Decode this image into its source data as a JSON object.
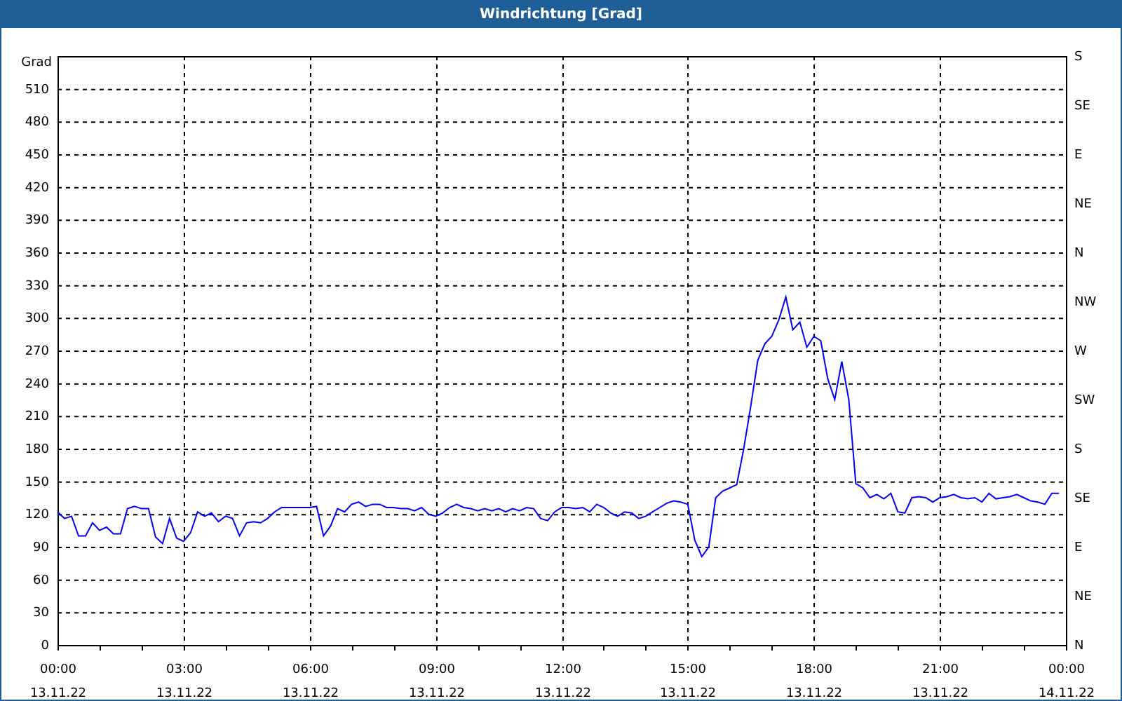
{
  "window": {
    "title": "Windrichtung [Grad]"
  },
  "chart": {
    "chart_data": {
      "type": "line",
      "grid": true,
      "ylabel": "Grad",
      "ylim": [
        0,
        540
      ],
      "yticks": [
        0,
        30,
        60,
        90,
        120,
        150,
        180,
        210,
        240,
        270,
        300,
        330,
        360,
        390,
        420,
        450,
        480,
        510
      ],
      "categories": [
        "00:00\n13.11.22",
        null,
        null,
        null,
        null,
        null,
        null,
        null,
        null,
        null,
        null,
        null,
        null,
        null,
        null,
        null,
        null,
        null,
        "03:00\n13.11.22",
        null,
        null,
        null,
        null,
        null,
        null,
        null,
        null,
        null,
        null,
        null,
        null,
        null,
        null,
        null,
        null,
        null,
        "06:00\n13.11.22",
        null,
        null,
        null,
        null,
        null,
        null,
        null,
        null,
        null,
        null,
        null,
        null,
        null,
        null,
        null,
        null,
        null,
        "09:00\n13.11.22",
        null,
        null,
        null,
        null,
        null,
        null,
        null,
        null,
        null,
        null,
        null,
        null,
        null,
        null,
        null,
        null,
        null,
        "12:00\n13.11.22",
        null,
        null,
        null,
        null,
        null,
        null,
        null,
        null,
        null,
        null,
        null,
        null,
        null,
        null,
        null,
        null,
        null,
        "15:00\n13.11.22",
        null,
        null,
        null,
        null,
        null,
        null,
        null,
        null,
        null,
        null,
        null,
        null,
        null,
        null,
        null,
        null,
        null,
        "18:00\n13.11.22",
        null,
        null,
        null,
        null,
        null,
        null,
        null,
        null,
        null,
        null,
        null,
        null,
        null,
        null,
        null,
        null,
        null,
        "21:00\n13.11.22",
        null,
        null,
        null,
        null,
        null,
        null,
        null,
        null,
        null,
        null,
        null,
        null,
        null,
        null,
        null,
        null,
        null,
        "00:00\n14.11.22"
      ],
      "series": [
        {
          "color": "#0000ff",
          "values": [
            122,
            116,
            118,
            100,
            100,
            112,
            105,
            108,
            102,
            102,
            125,
            127,
            125,
            125,
            99,
            93,
            116,
            98,
            95,
            103,
            122,
            118,
            121,
            113,
            118,
            116,
            100,
            112,
            113,
            112,
            116,
            122,
            126,
            126,
            126,
            126,
            126,
            127,
            100,
            109,
            125,
            122,
            129,
            131,
            127,
            129,
            129,
            126,
            126,
            125,
            125,
            123,
            126,
            120,
            118,
            121,
            126,
            129,
            126,
            125,
            123,
            125,
            123,
            125,
            122,
            125,
            123,
            126,
            125,
            116,
            114,
            122,
            126,
            126,
            125,
            126,
            122,
            129,
            126,
            121,
            118,
            122,
            121,
            116,
            118,
            122,
            126,
            130,
            132,
            131,
            129,
            96,
            81,
            90,
            135,
            141,
            144,
            147,
            180,
            219,
            261,
            276,
            283,
            298,
            319,
            289,
            296,
            273,
            283,
            279,
            244,
            225,
            260,
            225,
            148,
            144,
            135,
            138,
            134,
            139,
            122,
            121,
            135,
            136,
            135,
            131,
            135,
            136,
            138,
            135,
            134,
            135,
            131,
            139,
            134,
            135,
            136,
            138,
            135,
            132,
            131,
            129,
            139,
            139,
            null
          ]
        }
      ]
    },
    "right_axis": [
      {
        "label": "S"
      },
      {
        "label": "SE"
      },
      {
        "label": "E"
      },
      {
        "label": "NE"
      },
      {
        "label": "N"
      },
      {
        "label": "NW"
      },
      {
        "label": "W"
      },
      {
        "label": "SW"
      },
      {
        "label": "S"
      },
      {
        "label": "SE"
      },
      {
        "label": "E"
      },
      {
        "label": "NE"
      },
      {
        "label": "N"
      }
    ]
  }
}
